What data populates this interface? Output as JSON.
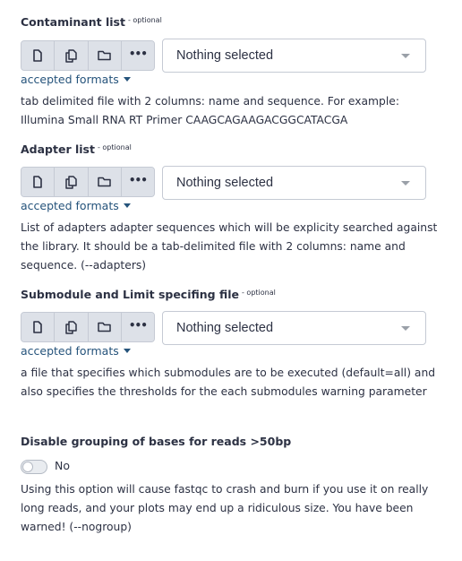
{
  "params": [
    {
      "title": "Contaminant list",
      "optional_label": "- optional",
      "select_value": "Nothing selected",
      "formats_label": "accepted formats",
      "help": "tab delimited file with 2 columns: name and sequence. For example: Illumina Small RNA RT Primer CAAGCAGAAGACGGCATACGA"
    },
    {
      "title": "Adapter list",
      "optional_label": "- optional",
      "select_value": "Nothing selected",
      "formats_label": "accepted formats",
      "help": "List of adapters adapter sequences which will be explicity searched against the library. It should be a tab-delimited file with 2 columns: name and sequence. (--adapters)"
    },
    {
      "title": "Submodule and Limit specifing file",
      "optional_label": "- optional",
      "select_value": "Nothing selected",
      "formats_label": "accepted formats",
      "help": "a file that specifies which submodules are to be executed (default=all) and also specifies the thresholds for the each submodules warning parameter"
    }
  ],
  "nogroup": {
    "title": "Disable grouping of bases for reads >50bp",
    "toggle_label": "No",
    "toggle_on": false,
    "help": "Using this option will cause fastqc to crash and burn if you use it on really long reads, and your plots may end up a ridiculous size. You have been warned! (--nogroup)"
  },
  "icons": [
    "file-icon",
    "copy-icon",
    "folder-icon",
    "more-icon",
    "caret-down-icon"
  ],
  "colors": {
    "link": "#25537b",
    "text": "#2c3143",
    "button_bg": "#dde1e8",
    "border": "#c5cad4"
  }
}
